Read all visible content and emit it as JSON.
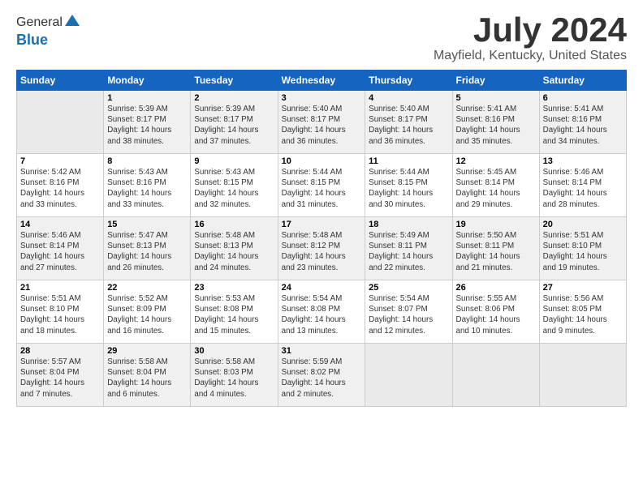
{
  "logo": {
    "line1": "General",
    "line2": "Blue"
  },
  "title": "July 2024",
  "location": "Mayfield, Kentucky, United States",
  "weekdays": [
    "Sunday",
    "Monday",
    "Tuesday",
    "Wednesday",
    "Thursday",
    "Friday",
    "Saturday"
  ],
  "weeks": [
    [
      {
        "day": "",
        "info": ""
      },
      {
        "day": "1",
        "info": "Sunrise: 5:39 AM\nSunset: 8:17 PM\nDaylight: 14 hours\nand 38 minutes."
      },
      {
        "day": "2",
        "info": "Sunrise: 5:39 AM\nSunset: 8:17 PM\nDaylight: 14 hours\nand 37 minutes."
      },
      {
        "day": "3",
        "info": "Sunrise: 5:40 AM\nSunset: 8:17 PM\nDaylight: 14 hours\nand 36 minutes."
      },
      {
        "day": "4",
        "info": "Sunrise: 5:40 AM\nSunset: 8:17 PM\nDaylight: 14 hours\nand 36 minutes."
      },
      {
        "day": "5",
        "info": "Sunrise: 5:41 AM\nSunset: 8:16 PM\nDaylight: 14 hours\nand 35 minutes."
      },
      {
        "day": "6",
        "info": "Sunrise: 5:41 AM\nSunset: 8:16 PM\nDaylight: 14 hours\nand 34 minutes."
      }
    ],
    [
      {
        "day": "7",
        "info": "Sunrise: 5:42 AM\nSunset: 8:16 PM\nDaylight: 14 hours\nand 33 minutes."
      },
      {
        "day": "8",
        "info": "Sunrise: 5:43 AM\nSunset: 8:16 PM\nDaylight: 14 hours\nand 33 minutes."
      },
      {
        "day": "9",
        "info": "Sunrise: 5:43 AM\nSunset: 8:15 PM\nDaylight: 14 hours\nand 32 minutes."
      },
      {
        "day": "10",
        "info": "Sunrise: 5:44 AM\nSunset: 8:15 PM\nDaylight: 14 hours\nand 31 minutes."
      },
      {
        "day": "11",
        "info": "Sunrise: 5:44 AM\nSunset: 8:15 PM\nDaylight: 14 hours\nand 30 minutes."
      },
      {
        "day": "12",
        "info": "Sunrise: 5:45 AM\nSunset: 8:14 PM\nDaylight: 14 hours\nand 29 minutes."
      },
      {
        "day": "13",
        "info": "Sunrise: 5:46 AM\nSunset: 8:14 PM\nDaylight: 14 hours\nand 28 minutes."
      }
    ],
    [
      {
        "day": "14",
        "info": "Sunrise: 5:46 AM\nSunset: 8:14 PM\nDaylight: 14 hours\nand 27 minutes."
      },
      {
        "day": "15",
        "info": "Sunrise: 5:47 AM\nSunset: 8:13 PM\nDaylight: 14 hours\nand 26 minutes."
      },
      {
        "day": "16",
        "info": "Sunrise: 5:48 AM\nSunset: 8:13 PM\nDaylight: 14 hours\nand 24 minutes."
      },
      {
        "day": "17",
        "info": "Sunrise: 5:48 AM\nSunset: 8:12 PM\nDaylight: 14 hours\nand 23 minutes."
      },
      {
        "day": "18",
        "info": "Sunrise: 5:49 AM\nSunset: 8:11 PM\nDaylight: 14 hours\nand 22 minutes."
      },
      {
        "day": "19",
        "info": "Sunrise: 5:50 AM\nSunset: 8:11 PM\nDaylight: 14 hours\nand 21 minutes."
      },
      {
        "day": "20",
        "info": "Sunrise: 5:51 AM\nSunset: 8:10 PM\nDaylight: 14 hours\nand 19 minutes."
      }
    ],
    [
      {
        "day": "21",
        "info": "Sunrise: 5:51 AM\nSunset: 8:10 PM\nDaylight: 14 hours\nand 18 minutes."
      },
      {
        "day": "22",
        "info": "Sunrise: 5:52 AM\nSunset: 8:09 PM\nDaylight: 14 hours\nand 16 minutes."
      },
      {
        "day": "23",
        "info": "Sunrise: 5:53 AM\nSunset: 8:08 PM\nDaylight: 14 hours\nand 15 minutes."
      },
      {
        "day": "24",
        "info": "Sunrise: 5:54 AM\nSunset: 8:08 PM\nDaylight: 14 hours\nand 13 minutes."
      },
      {
        "day": "25",
        "info": "Sunrise: 5:54 AM\nSunset: 8:07 PM\nDaylight: 14 hours\nand 12 minutes."
      },
      {
        "day": "26",
        "info": "Sunrise: 5:55 AM\nSunset: 8:06 PM\nDaylight: 14 hours\nand 10 minutes."
      },
      {
        "day": "27",
        "info": "Sunrise: 5:56 AM\nSunset: 8:05 PM\nDaylight: 14 hours\nand 9 minutes."
      }
    ],
    [
      {
        "day": "28",
        "info": "Sunrise: 5:57 AM\nSunset: 8:04 PM\nDaylight: 14 hours\nand 7 minutes."
      },
      {
        "day": "29",
        "info": "Sunrise: 5:58 AM\nSunset: 8:04 PM\nDaylight: 14 hours\nand 6 minutes."
      },
      {
        "day": "30",
        "info": "Sunrise: 5:58 AM\nSunset: 8:03 PM\nDaylight: 14 hours\nand 4 minutes."
      },
      {
        "day": "31",
        "info": "Sunrise: 5:59 AM\nSunset: 8:02 PM\nDaylight: 14 hours\nand 2 minutes."
      },
      {
        "day": "",
        "info": ""
      },
      {
        "day": "",
        "info": ""
      },
      {
        "day": "",
        "info": ""
      }
    ]
  ]
}
